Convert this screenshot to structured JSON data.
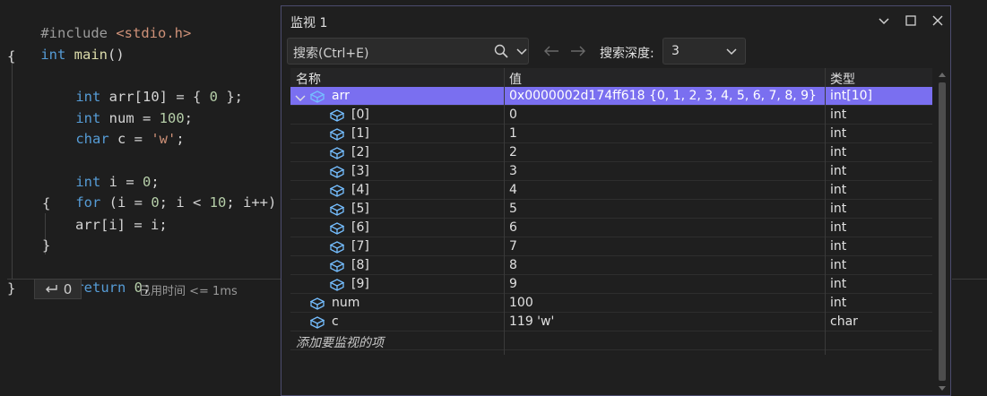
{
  "editor": {
    "lines": [
      {
        "t": "include",
        "pre": "#include ",
        "post": "<stdio.h>"
      },
      {
        "t": "main"
      },
      {
        "t": "brace_open",
        "text": "{"
      },
      {
        "t": "decl",
        "type": "int",
        "rest": "arr[10] = { ",
        "num": "0",
        "end": " };"
      },
      {
        "t": "decl2",
        "type": "int",
        "rest": "num = ",
        "num": "100",
        "end": ";"
      },
      {
        "t": "decl3",
        "type": "char",
        "rest": "c = ",
        "str": "'w'",
        "end": ";"
      },
      {
        "t": "blank"
      },
      {
        "t": "decl2b",
        "type": "int",
        "rest": "i = ",
        "num": "0",
        "end": ";"
      },
      {
        "t": "for"
      },
      {
        "t": "brace_inner_open",
        "text": "{"
      },
      {
        "t": "assign",
        "text": "arr[i] = i;"
      },
      {
        "t": "brace_inner_close",
        "text": "}"
      },
      {
        "t": "return",
        "kw": "return",
        "num": "0",
        "end": ";"
      },
      {
        "t": "brace_close",
        "text": "}"
      }
    ],
    "main_line": {
      "type": "int",
      "name": "main",
      "params": "()"
    },
    "for_line": {
      "kw": "for",
      "a": " (i = ",
      "n1": "0",
      "b": "; i < ",
      "n2": "10",
      "c": "; i++)"
    },
    "perf_badge": {
      "icon": "return-arrow-icon",
      "value": "0"
    },
    "perf_time": "已用时间 <= 1ms"
  },
  "watch": {
    "title": "监视 1",
    "window_buttons": [
      "chevron-down-icon",
      "maximize-icon",
      "close-icon"
    ],
    "search_placeholder": "搜索(Ctrl+E)",
    "depth_label": "搜索深度:",
    "depth_value": "3",
    "columns": {
      "name": "名称",
      "value": "值",
      "type": "类型"
    },
    "rows": [
      {
        "name": "arr",
        "value": "0x0000002d174ff618 {0, 1, 2, 3, 4, 5, 6, 7, 8, 9}",
        "type": "int[10]",
        "level": 0,
        "expanded": true,
        "selected": true
      },
      {
        "name": "[0]",
        "value": "0",
        "type": "int",
        "level": 1
      },
      {
        "name": "[1]",
        "value": "1",
        "type": "int",
        "level": 1
      },
      {
        "name": "[2]",
        "value": "2",
        "type": "int",
        "level": 1
      },
      {
        "name": "[3]",
        "value": "3",
        "type": "int",
        "level": 1
      },
      {
        "name": "[4]",
        "value": "4",
        "type": "int",
        "level": 1
      },
      {
        "name": "[5]",
        "value": "5",
        "type": "int",
        "level": 1
      },
      {
        "name": "[6]",
        "value": "6",
        "type": "int",
        "level": 1
      },
      {
        "name": "[7]",
        "value": "7",
        "type": "int",
        "level": 1
      },
      {
        "name": "[8]",
        "value": "8",
        "type": "int",
        "level": 1
      },
      {
        "name": "[9]",
        "value": "9",
        "type": "int",
        "level": 1
      },
      {
        "name": "num",
        "value": "100",
        "type": "int",
        "level": 0
      },
      {
        "name": "c",
        "value": "119 'w'",
        "type": "char",
        "level": 0
      }
    ],
    "add_item_placeholder": "添加要监视的项"
  },
  "colors": {
    "selected_row": "#7a6ff0",
    "accent": "#4c4c6e",
    "keyword": "#569cd6",
    "icon": "#75beff"
  }
}
